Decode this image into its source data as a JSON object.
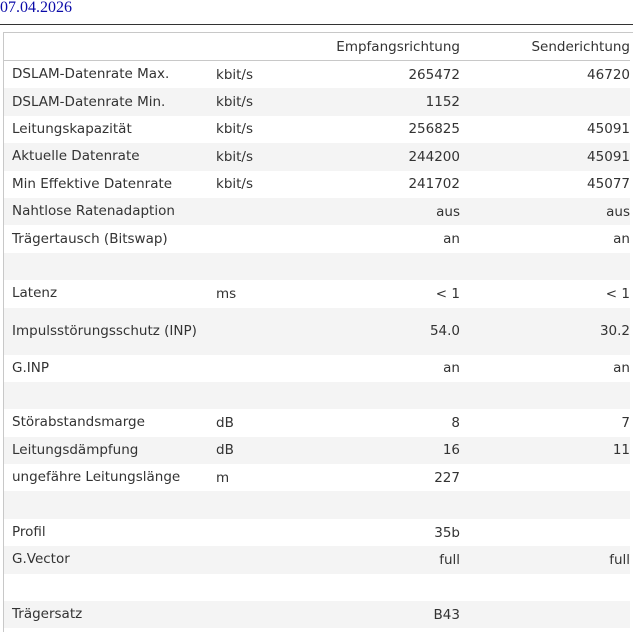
{
  "date": "07.04.2026",
  "columns": {
    "label": "",
    "unit": "",
    "down": "Empfangsrichtung",
    "up": "Senderichtung"
  },
  "rows": [
    {
      "label": "DSLAM-Datenrate Max.",
      "unit": "kbit/s",
      "down": "265472",
      "up": "46720"
    },
    {
      "label": "DSLAM-Datenrate Min.",
      "unit": "kbit/s",
      "down": "1152",
      "up": ""
    },
    {
      "label": "Leitungskapazität",
      "unit": "kbit/s",
      "down": "256825",
      "up": "45091"
    },
    {
      "label": "Aktuelle Datenrate",
      "unit": "kbit/s",
      "down": "244200",
      "up": "45091"
    },
    {
      "label": "Min Effektive Datenrate",
      "unit": "kbit/s",
      "down": "241702",
      "up": "45077"
    },
    {
      "label": "Nahtlose Ratenadaption",
      "unit": "",
      "down": "aus",
      "up": "aus"
    },
    {
      "label": "Trägertausch (Bitswap)",
      "unit": "",
      "down": "an",
      "up": "an"
    },
    {
      "label": "",
      "unit": "",
      "down": "",
      "up": ""
    },
    {
      "label": "Latenz",
      "unit": "ms",
      "down": "< 1",
      "up": "< 1"
    },
    {
      "label": "Impulsstörungsschutz (INP)",
      "unit": "",
      "down": "54.0",
      "up": "30.2"
    },
    {
      "label": "G.INP",
      "unit": "",
      "down": "an",
      "up": "an"
    },
    {
      "label": "",
      "unit": "",
      "down": "",
      "up": ""
    },
    {
      "label": "Störabstandsmarge",
      "unit": "dB",
      "down": "8",
      "up": "7"
    },
    {
      "label": "Leitungsdämpfung",
      "unit": "dB",
      "down": "16",
      "up": "11"
    },
    {
      "label": "ungefähre Leitungslänge",
      "unit": "m",
      "down": "227",
      "up": ""
    },
    {
      "label": "",
      "unit": "",
      "down": "",
      "up": ""
    },
    {
      "label": "Profil",
      "unit": "",
      "down": "35b",
      "up": ""
    },
    {
      "label": "G.Vector",
      "unit": "",
      "down": "full",
      "up": "full"
    },
    {
      "label": "",
      "unit": "",
      "down": "",
      "up": ""
    },
    {
      "label": "Trägersatz",
      "unit": "",
      "down": "B43",
      "up": ""
    }
  ]
}
